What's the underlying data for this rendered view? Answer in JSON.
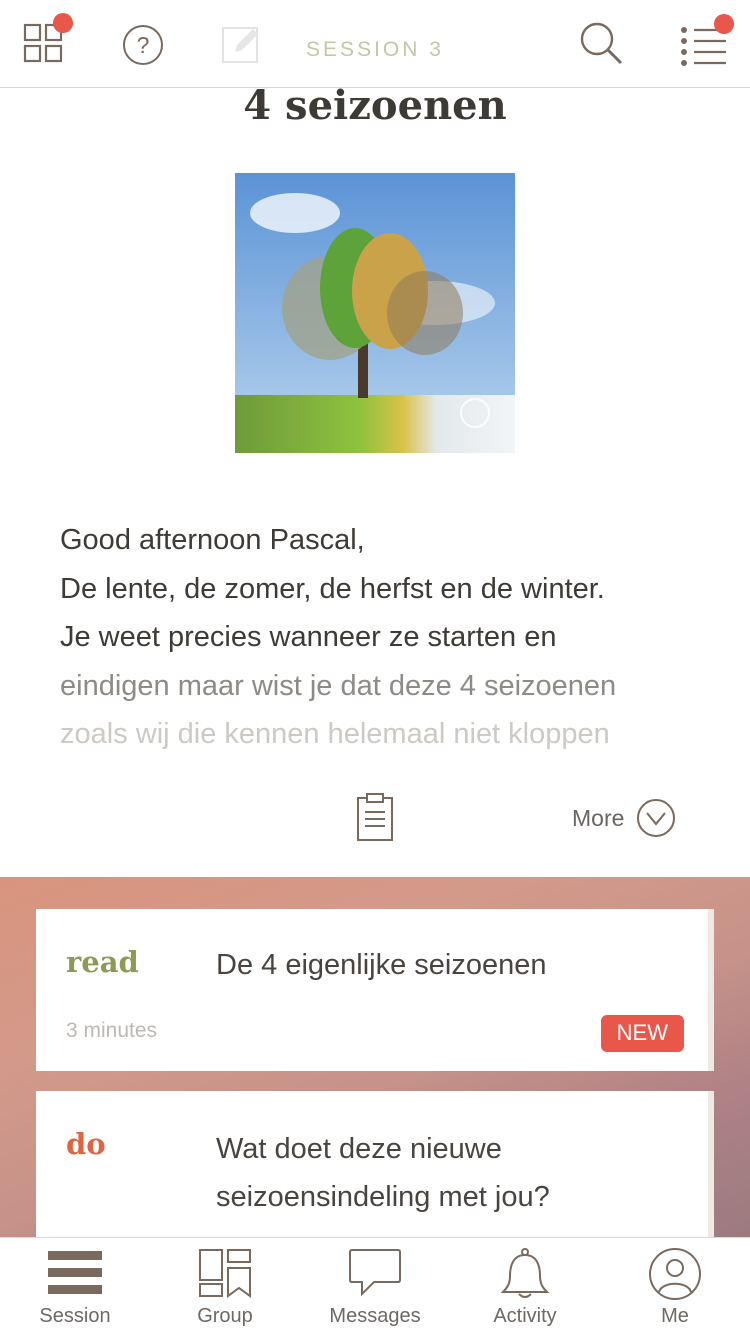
{
  "header": {
    "session_label": "SESSION 3",
    "colors": {
      "icon": "#7a6a5e",
      "notification": "#e8574a",
      "muted": "#c5c5a8"
    }
  },
  "content": {
    "title": "4 seizoenen",
    "intro_lines": [
      "Good afternoon Pascal,",
      "De lente, de zomer, de herfst en de winter.",
      "Je weet precies wanneer ze starten en",
      "eindigen maar wist je dat deze 4 seizoenen",
      "zoals wij die kennen helemaal niet kloppen"
    ],
    "more_label": "More"
  },
  "activities": [
    {
      "kind": "read",
      "title": "De 4 eigenlijke seizoenen",
      "duration": "3 minutes",
      "badge": "NEW"
    },
    {
      "kind": "do",
      "title": "Wat doet deze nieuwe seizoensindeling met jou?"
    }
  ],
  "nav": [
    {
      "label": "Session",
      "icon": "session-icon"
    },
    {
      "label": "Group",
      "icon": "group-icon"
    },
    {
      "label": "Messages",
      "icon": "messages-icon"
    },
    {
      "label": "Activity",
      "icon": "bell-icon"
    },
    {
      "label": "Me",
      "icon": "profile-icon"
    }
  ]
}
